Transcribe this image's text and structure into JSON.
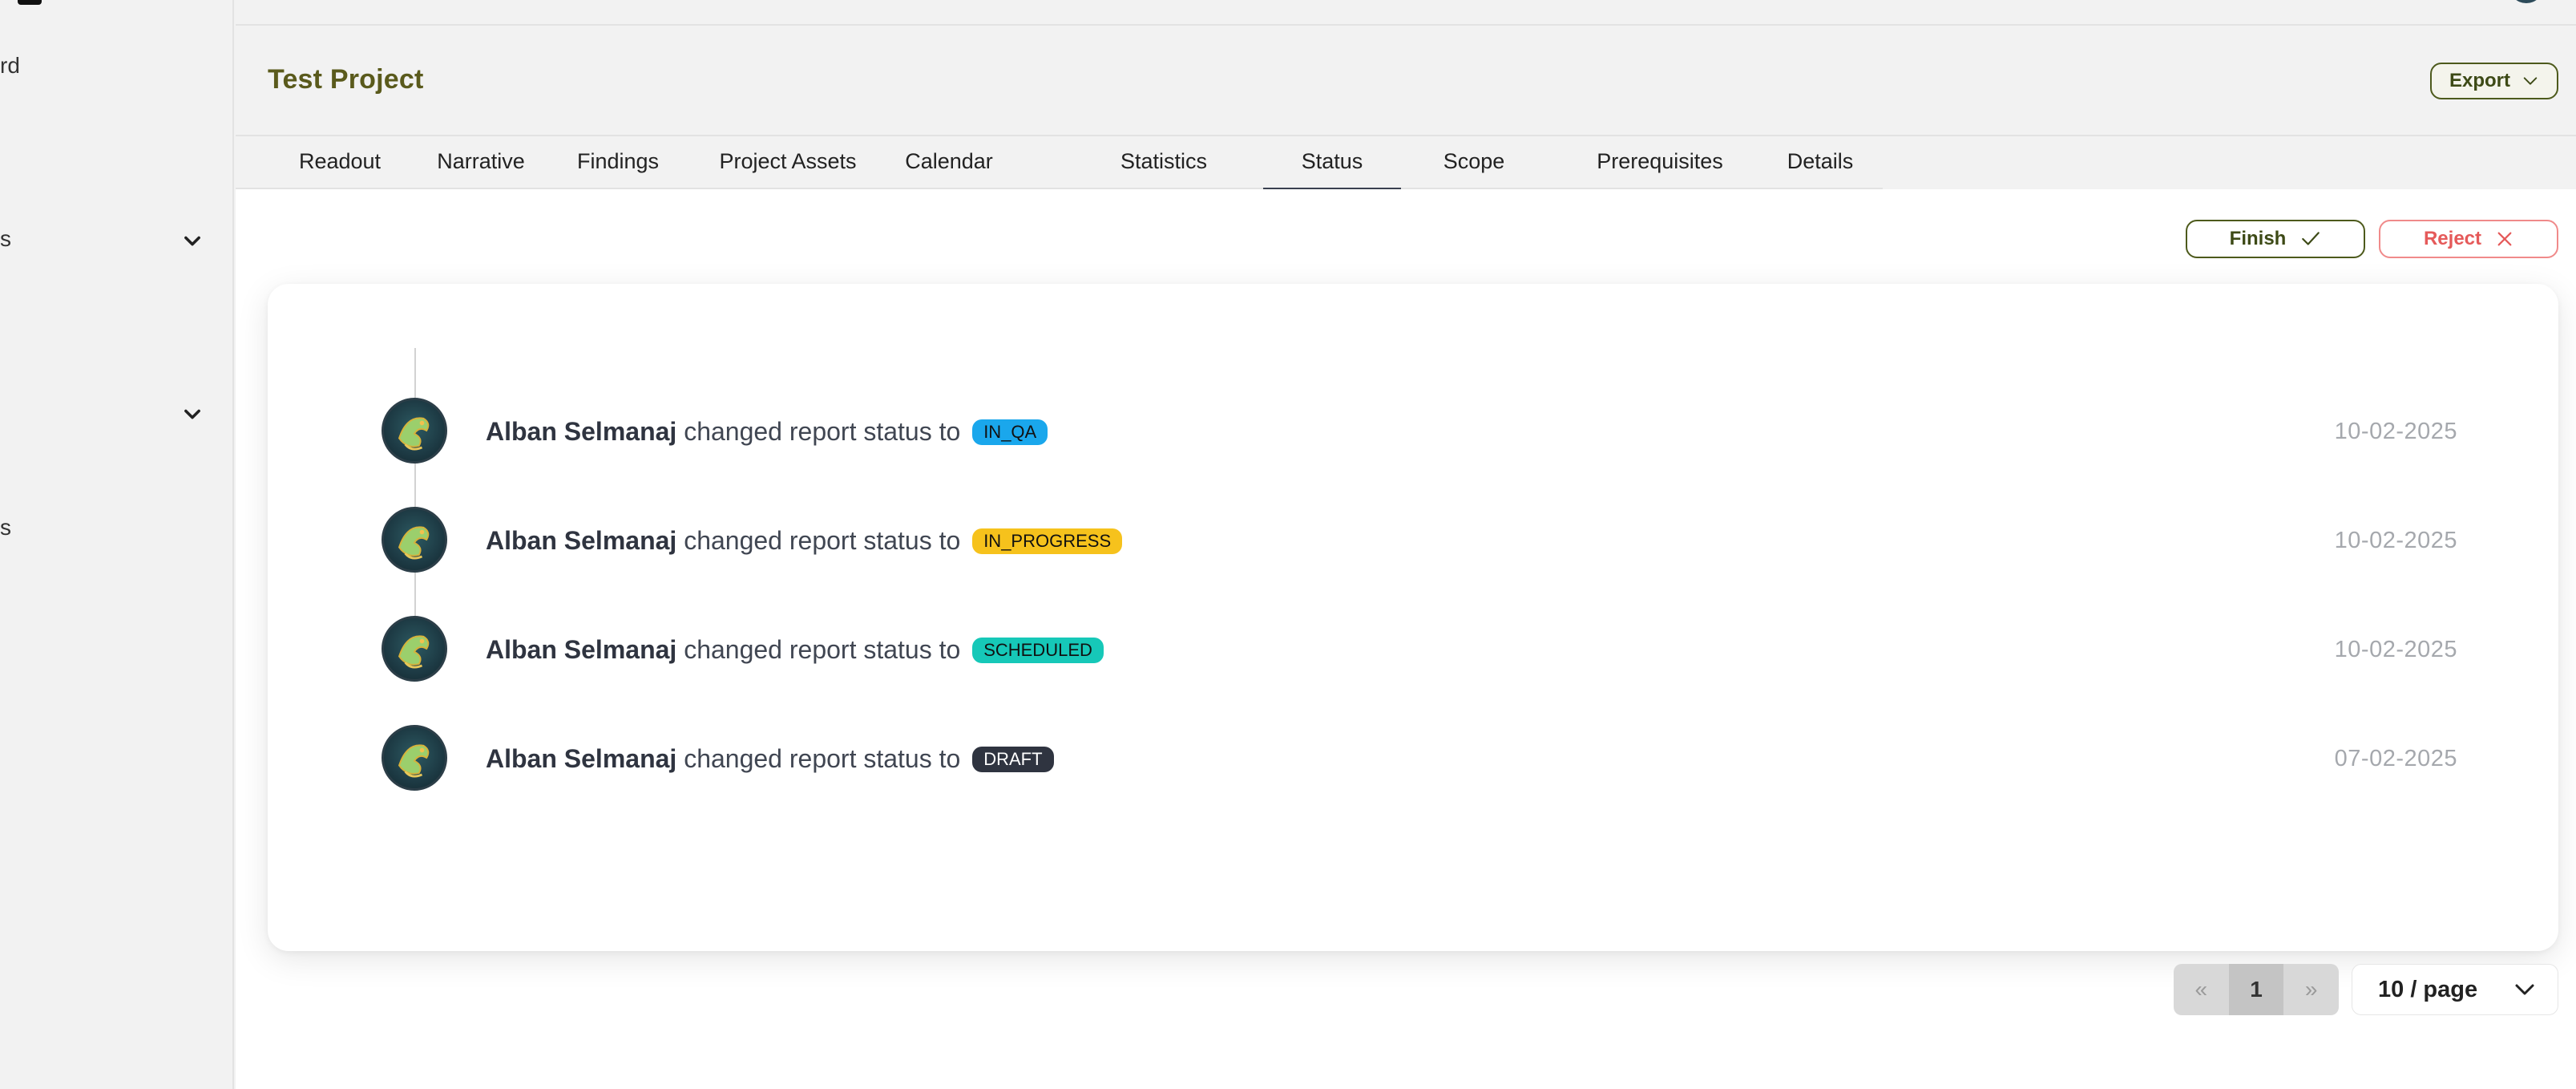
{
  "sidebar": {
    "items": [
      {
        "label": "rd"
      },
      {
        "label": "s"
      },
      {
        "label": ""
      },
      {
        "label": "s"
      }
    ]
  },
  "header": {
    "title": "Test Project",
    "export_label": "Export"
  },
  "tabs": [
    {
      "label": "Readout"
    },
    {
      "label": "Narrative"
    },
    {
      "label": "Findings"
    },
    {
      "label": "Project Assets"
    },
    {
      "label": "Calendar"
    },
    {
      "label": "Statistics"
    },
    {
      "label": "Status",
      "active": true
    },
    {
      "label": "Scope"
    },
    {
      "label": "Prerequisites"
    },
    {
      "label": "Details"
    }
  ],
  "actions": {
    "finish_label": "Finish",
    "reject_label": "Reject"
  },
  "timeline": [
    {
      "user": "Alban Selmanaj",
      "action": "changed report status to",
      "status": "IN_QA",
      "date": "10-02-2025"
    },
    {
      "user": "Alban Selmanaj",
      "action": "changed report status to",
      "status": "IN_PROGRESS",
      "date": "10-02-2025"
    },
    {
      "user": "Alban Selmanaj",
      "action": "changed report status to",
      "status": "SCHEDULED",
      "date": "10-02-2025"
    },
    {
      "user": "Alban Selmanaj",
      "action": "changed report status to",
      "status": "DRAFT",
      "date": "07-02-2025"
    }
  ],
  "pagination": {
    "prev": "«",
    "current_page": "1",
    "next": "»",
    "page_size": "10 / page"
  },
  "colors": {
    "accent": "#4d5a1c",
    "reject": "#e55a5a",
    "in_qa": "#1aa7ec",
    "in_progress": "#f6c21c",
    "scheduled": "#16c8b8",
    "draft": "#2f3440"
  }
}
